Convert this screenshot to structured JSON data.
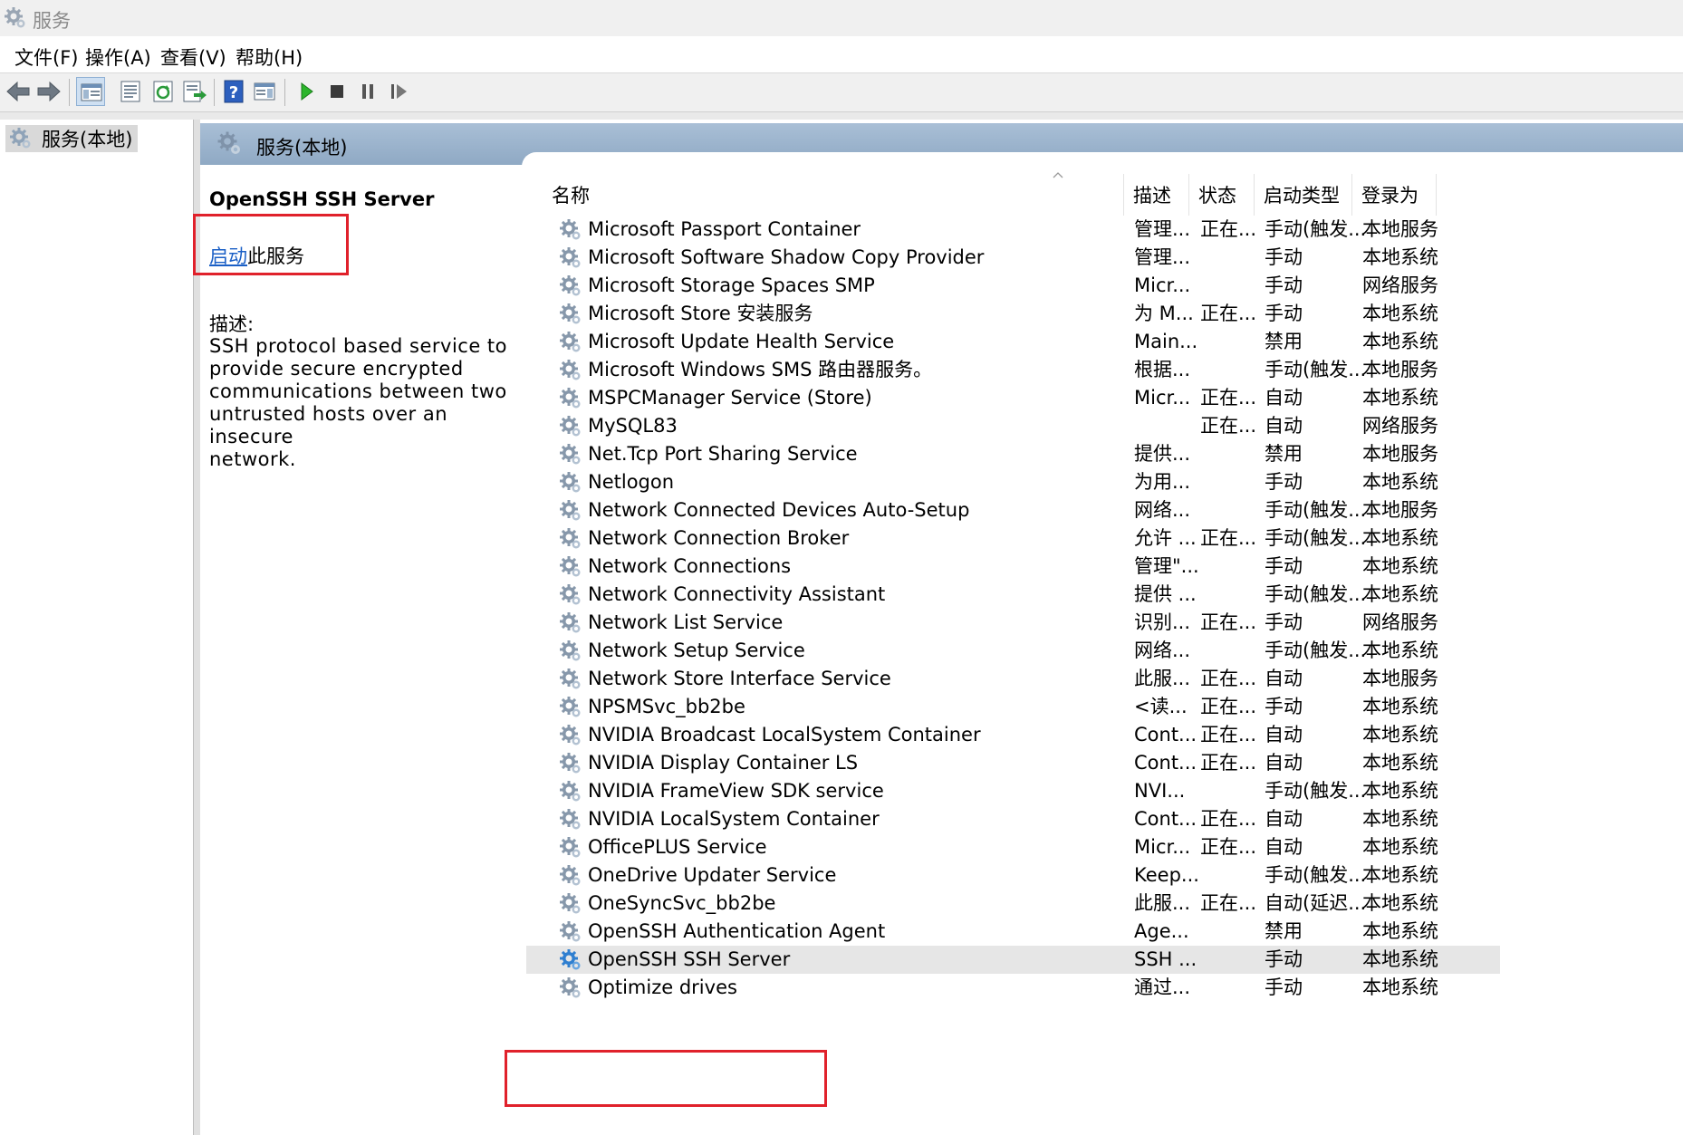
{
  "window": {
    "title": "服务"
  },
  "menu": [
    "文件(F)",
    "操作(A)",
    "查看(V)",
    "帮助(H)"
  ],
  "toolbar": {
    "buttons": [
      "back-icon",
      "forward-icon",
      "show-hide-console-tree-icon",
      "properties-icon",
      "refresh-icon",
      "export-list-icon",
      "help-icon",
      "show-hide-action-pane-icon",
      "start-service-icon",
      "stop-service-icon",
      "pause-service-icon",
      "restart-service-icon"
    ],
    "colors": {
      "play": "#2bb52b",
      "stop": "#3a3a3a",
      "help": "#2c5fbe"
    }
  },
  "tree": {
    "selected_label": "服务(本地)"
  },
  "banner": {
    "title": "服务(本地)"
  },
  "details": {
    "service_name": "OpenSSH SSH Server",
    "start_link": "启动",
    "start_suffix": "此服务",
    "desc_label": "描述:",
    "desc_lines": [
      "SSH protocol based service to",
      "provide secure encrypted",
      "communications between two",
      "untrusted hosts over an insecure",
      "network."
    ]
  },
  "columns": [
    "名称",
    "描述",
    "状态",
    "启动类型",
    "登录为"
  ],
  "services": [
    {
      "name": "Microsoft Passport Container",
      "desc": "管理...",
      "status": "正在...",
      "startup": "手动(触发...",
      "logon": "本地服务"
    },
    {
      "name": "Microsoft Software Shadow Copy Provider",
      "desc": "管理...",
      "status": "",
      "startup": "手动",
      "logon": "本地系统"
    },
    {
      "name": "Microsoft Storage Spaces SMP",
      "desc": "Micr...",
      "status": "",
      "startup": "手动",
      "logon": "网络服务"
    },
    {
      "name": "Microsoft Store 安装服务",
      "desc": "为 M...",
      "status": "正在...",
      "startup": "手动",
      "logon": "本地系统"
    },
    {
      "name": "Microsoft Update Health Service",
      "desc": "Main...",
      "status": "",
      "startup": "禁用",
      "logon": "本地系统"
    },
    {
      "name": "Microsoft Windows SMS 路由器服务。",
      "desc": "根据...",
      "status": "",
      "startup": "手动(触发...",
      "logon": "本地服务"
    },
    {
      "name": "MSPCManager Service (Store)",
      "desc": "Micr...",
      "status": "正在...",
      "startup": "自动",
      "logon": "本地系统"
    },
    {
      "name": "MySQL83",
      "desc": "",
      "status": "正在...",
      "startup": "自动",
      "logon": "网络服务"
    },
    {
      "name": "Net.Tcp Port Sharing Service",
      "desc": "提供...",
      "status": "",
      "startup": "禁用",
      "logon": "本地服务"
    },
    {
      "name": "Netlogon",
      "desc": "为用...",
      "status": "",
      "startup": "手动",
      "logon": "本地系统"
    },
    {
      "name": "Network Connected Devices Auto-Setup",
      "desc": "网络...",
      "status": "",
      "startup": "手动(触发...",
      "logon": "本地服务"
    },
    {
      "name": "Network Connection Broker",
      "desc": "允许 ...",
      "status": "正在...",
      "startup": "手动(触发...",
      "logon": "本地系统"
    },
    {
      "name": "Network Connections",
      "desc": "管理\"...",
      "status": "",
      "startup": "手动",
      "logon": "本地系统"
    },
    {
      "name": "Network Connectivity Assistant",
      "desc": "提供 ...",
      "status": "",
      "startup": "手动(触发...",
      "logon": "本地系统"
    },
    {
      "name": "Network List Service",
      "desc": "识别...",
      "status": "正在...",
      "startup": "手动",
      "logon": "网络服务"
    },
    {
      "name": "Network Setup Service",
      "desc": "网络...",
      "status": "",
      "startup": "手动(触发...",
      "logon": "本地系统"
    },
    {
      "name": "Network Store Interface Service",
      "desc": "此服...",
      "status": "正在...",
      "startup": "自动",
      "logon": "本地服务"
    },
    {
      "name": "NPSMSvc_bb2be",
      "desc": "<读...",
      "status": "正在...",
      "startup": "手动",
      "logon": "本地系统"
    },
    {
      "name": "NVIDIA Broadcast LocalSystem Container",
      "desc": "Cont...",
      "status": "正在...",
      "startup": "自动",
      "logon": "本地系统"
    },
    {
      "name": "NVIDIA Display Container LS",
      "desc": "Cont...",
      "status": "正在...",
      "startup": "自动",
      "logon": "本地系统"
    },
    {
      "name": "NVIDIA FrameView SDK service",
      "desc": "NVI...",
      "status": "",
      "startup": "手动(触发...",
      "logon": "本地系统"
    },
    {
      "name": "NVIDIA LocalSystem Container",
      "desc": "Cont...",
      "status": "正在...",
      "startup": "自动",
      "logon": "本地系统"
    },
    {
      "name": "OfficePLUS Service",
      "desc": "Micr...",
      "status": "正在...",
      "startup": "自动",
      "logon": "本地系统"
    },
    {
      "name": "OneDrive Updater Service",
      "desc": "Keep...",
      "status": "",
      "startup": "手动(触发...",
      "logon": "本地系统"
    },
    {
      "name": "OneSyncSvc_bb2be",
      "desc": "此服...",
      "status": "正在...",
      "startup": "自动(延迟...",
      "logon": "本地系统"
    },
    {
      "name": "OpenSSH Authentication Agent",
      "desc": "Age...",
      "status": "",
      "startup": "禁用",
      "logon": "本地系统"
    },
    {
      "name": "OpenSSH SSH Server",
      "desc": "SSH ...",
      "status": "",
      "startup": "手动",
      "logon": "本地系统",
      "selected": true
    },
    {
      "name": "Optimize drives",
      "desc": "通过...",
      "status": "",
      "startup": "手动",
      "logon": "本地系统"
    }
  ],
  "highlight_color": "#e0212b"
}
